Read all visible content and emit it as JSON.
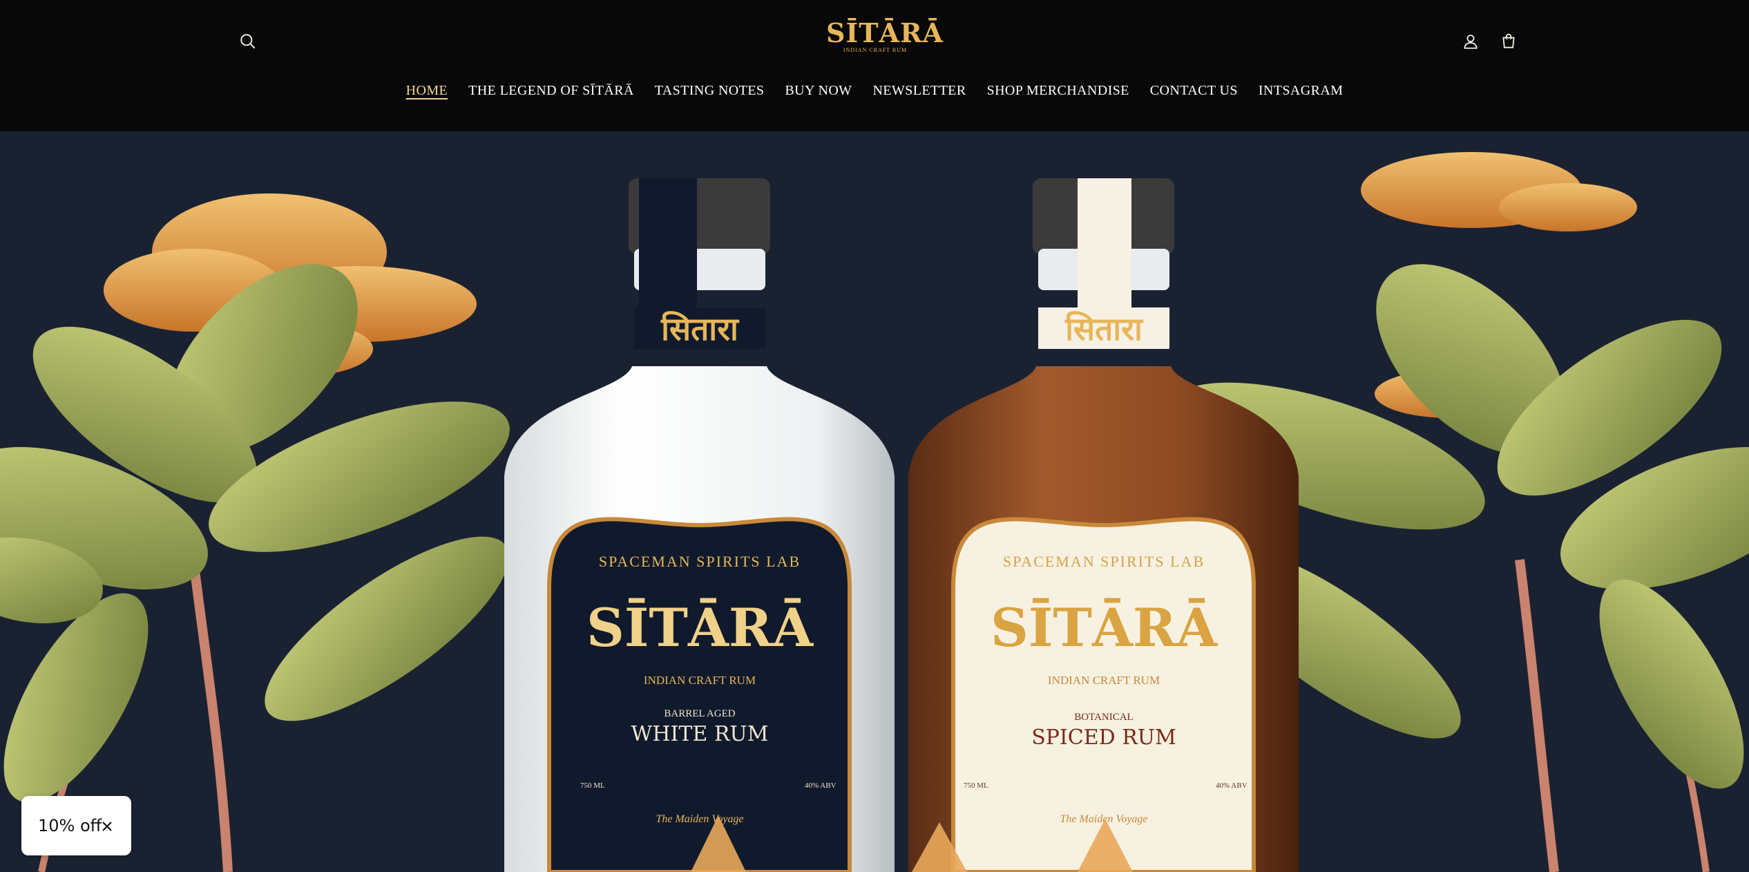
{
  "brand": {
    "logo_text": "SĪTĀRĀ",
    "logo_subtitle": "INDIAN CRAFT RUM",
    "gold": "#e7b65a"
  },
  "header": {
    "icons": [
      "search-icon",
      "account-icon",
      "cart-icon"
    ]
  },
  "nav": {
    "items": [
      {
        "label": "HOME",
        "active": true
      },
      {
        "label": "THE LEGEND OF SĪTĀRĀ"
      },
      {
        "label": "TASTING NOTES"
      },
      {
        "label": "BUY NOW"
      },
      {
        "label": "NEWSLETTER"
      },
      {
        "label": "SHOP MERCHANDISE"
      },
      {
        "label": "CONTACT US"
      },
      {
        "label": "INTSAGRAM"
      }
    ]
  },
  "hero": {
    "background": "#1a2232",
    "bottles": [
      {
        "maker": "SPACEMAN SPIRITS LAB",
        "name": "SĪTĀRĀ",
        "subtitle": "INDIAN CRAFT RUM",
        "variant_top": "BARREL AGED",
        "variant": "WHITE RUM",
        "volume": "750 ML",
        "abv": "40% ABV",
        "script": "The Maiden Voyage",
        "neck_text": "सितारा"
      },
      {
        "maker": "SPACEMAN SPIRITS LAB",
        "name": "SĪTĀRĀ",
        "subtitle": "INDIAN CRAFT RUM",
        "variant_top": "BOTANICAL",
        "variant": "SPICED RUM",
        "volume": "750 ML",
        "abv": "40% ABV",
        "script": "The Maiden Voyage",
        "neck_text": "सितारा"
      }
    ]
  },
  "discount": {
    "label": "10% off"
  }
}
